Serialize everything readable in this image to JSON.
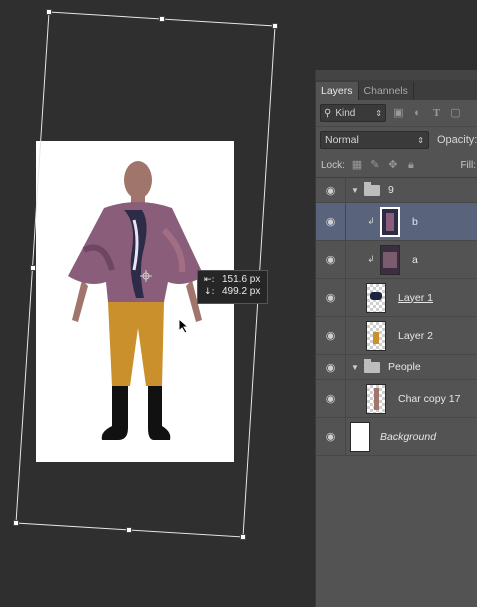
{
  "canvas": {
    "tooltip": {
      "width_value": "151.6 px",
      "height_value": "499.2 px"
    }
  },
  "panel": {
    "tabs": [
      {
        "label": "Layers",
        "active": true
      },
      {
        "label": "Channels",
        "active": false
      }
    ],
    "filter": {
      "kind_label": "Kind"
    },
    "blend_mode": "Normal",
    "opacity_label": "Opacity:",
    "lock_label": "Lock:",
    "fill_label": "Fill:",
    "layers": {
      "group_9": {
        "name": "9"
      },
      "b": {
        "name": "b"
      },
      "a": {
        "name": "a"
      },
      "layer1": {
        "name": "Layer 1"
      },
      "layer2": {
        "name": "Layer 2"
      },
      "people": {
        "name": "People"
      },
      "char_copy": {
        "name": "Char copy 17"
      },
      "background": {
        "name": "Background"
      }
    }
  },
  "colors": {
    "selected_row": "#59637b",
    "panel_bg": "#535353",
    "canvas_bg": "#2f2f2f"
  }
}
